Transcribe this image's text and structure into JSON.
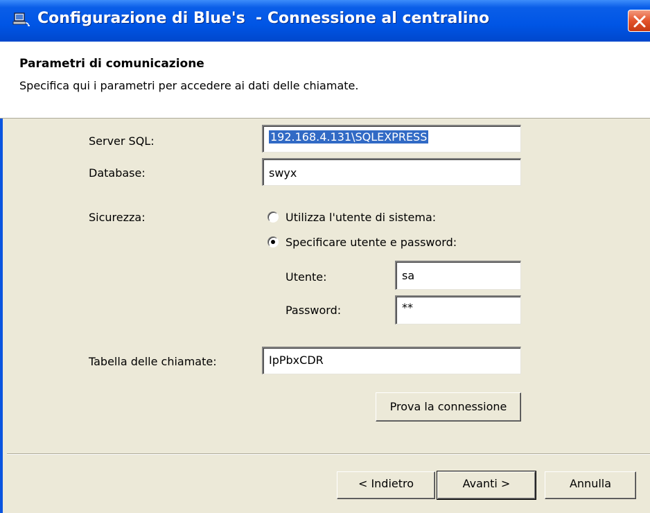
{
  "window": {
    "title": "Configurazione di Blue's  - Connessione al centralino"
  },
  "header": {
    "title": "Parametri di comunicazione",
    "subtitle": "Specifica qui i parametri per accedere ai dati delle chiamate."
  },
  "form": {
    "server_label": "Server SQL:",
    "server_value": "192.168.4.131\\SQLEXPRESS",
    "database_label": "Database:",
    "database_value": "swyx",
    "security_label": "Sicurezza:",
    "radio_system_label": "Utilizza l'utente di sistema:",
    "radio_custom_label": "Specificare utente e password:",
    "radio_selected": "custom",
    "user_label": "Utente:",
    "user_value": "sa",
    "password_label": "Password:",
    "password_value": "**",
    "table_label": "Tabella delle chiamate:",
    "table_value": "IpPbxCDR",
    "test_button": "Prova la connessione"
  },
  "footer": {
    "back_button": "< Indietro",
    "next_button": "Avanti >",
    "cancel_button": "Annulla"
  },
  "icons": {
    "window_icon": "computer-icon",
    "close_icon": "close-icon"
  },
  "colors": {
    "titlebar": "#0055e5",
    "dialog_bg": "#ece9d8",
    "selection": "#316ac5",
    "close_button": "#e3542c"
  }
}
